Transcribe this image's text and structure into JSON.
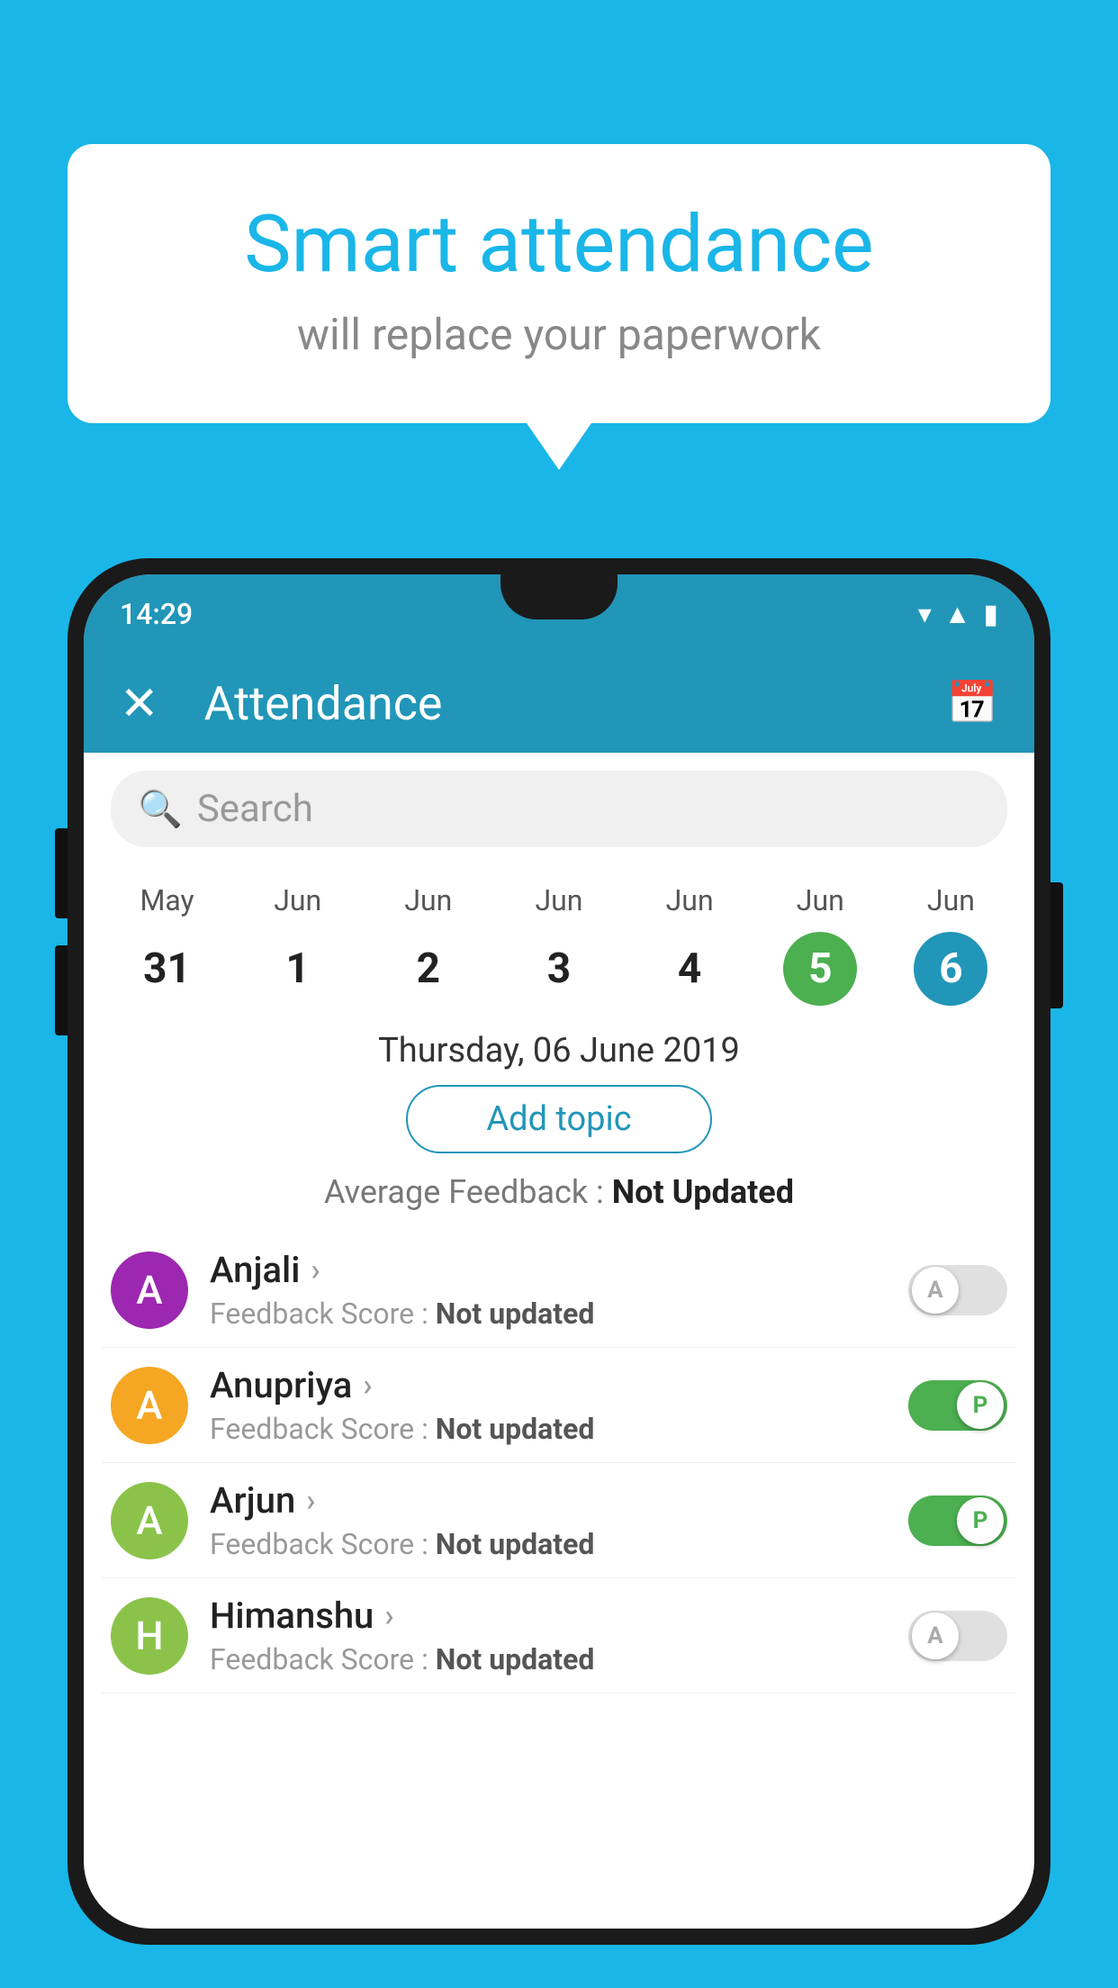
{
  "background_color": "#1ab6e8",
  "speech_bubble": {
    "title": "Smart attendance",
    "subtitle": "will replace your paperwork"
  },
  "status_bar": {
    "time": "14:29",
    "icons": [
      "wifi",
      "signal",
      "battery"
    ]
  },
  "app_bar": {
    "title": "Attendance",
    "close_label": "✕",
    "calendar_icon": "📅"
  },
  "search": {
    "placeholder": "Search"
  },
  "calendar": {
    "days": [
      {
        "month": "May",
        "date": "31",
        "state": "normal"
      },
      {
        "month": "Jun",
        "date": "1",
        "state": "normal"
      },
      {
        "month": "Jun",
        "date": "2",
        "state": "normal"
      },
      {
        "month": "Jun",
        "date": "3",
        "state": "normal"
      },
      {
        "month": "Jun",
        "date": "4",
        "state": "normal"
      },
      {
        "month": "Jun",
        "date": "5",
        "state": "today"
      },
      {
        "month": "Jun",
        "date": "6",
        "state": "selected"
      }
    ],
    "selected_date_label": "Thursday, 06 June 2019"
  },
  "add_topic_button": "Add topic",
  "avg_feedback": {
    "label": "Average Feedback : ",
    "value": "Not Updated"
  },
  "students": [
    {
      "name": "Anjali",
      "avatar_letter": "A",
      "avatar_color": "#9c27b0",
      "feedback": "Feedback Score : ",
      "feedback_value": "Not updated",
      "toggle_state": "off",
      "toggle_label": "A"
    },
    {
      "name": "Anupriya",
      "avatar_letter": "A",
      "avatar_color": "#f5a623",
      "feedback": "Feedback Score : ",
      "feedback_value": "Not updated",
      "toggle_state": "on",
      "toggle_label": "P"
    },
    {
      "name": "Arjun",
      "avatar_letter": "A",
      "avatar_color": "#8bc34a",
      "feedback": "Feedback Score : ",
      "feedback_value": "Not updated",
      "toggle_state": "on",
      "toggle_label": "P"
    },
    {
      "name": "Himanshu",
      "avatar_letter": "H",
      "avatar_color": "#8bc34a",
      "feedback": "Feedback Score : ",
      "feedback_value": "Not updated",
      "toggle_state": "off",
      "toggle_label": "A"
    }
  ]
}
